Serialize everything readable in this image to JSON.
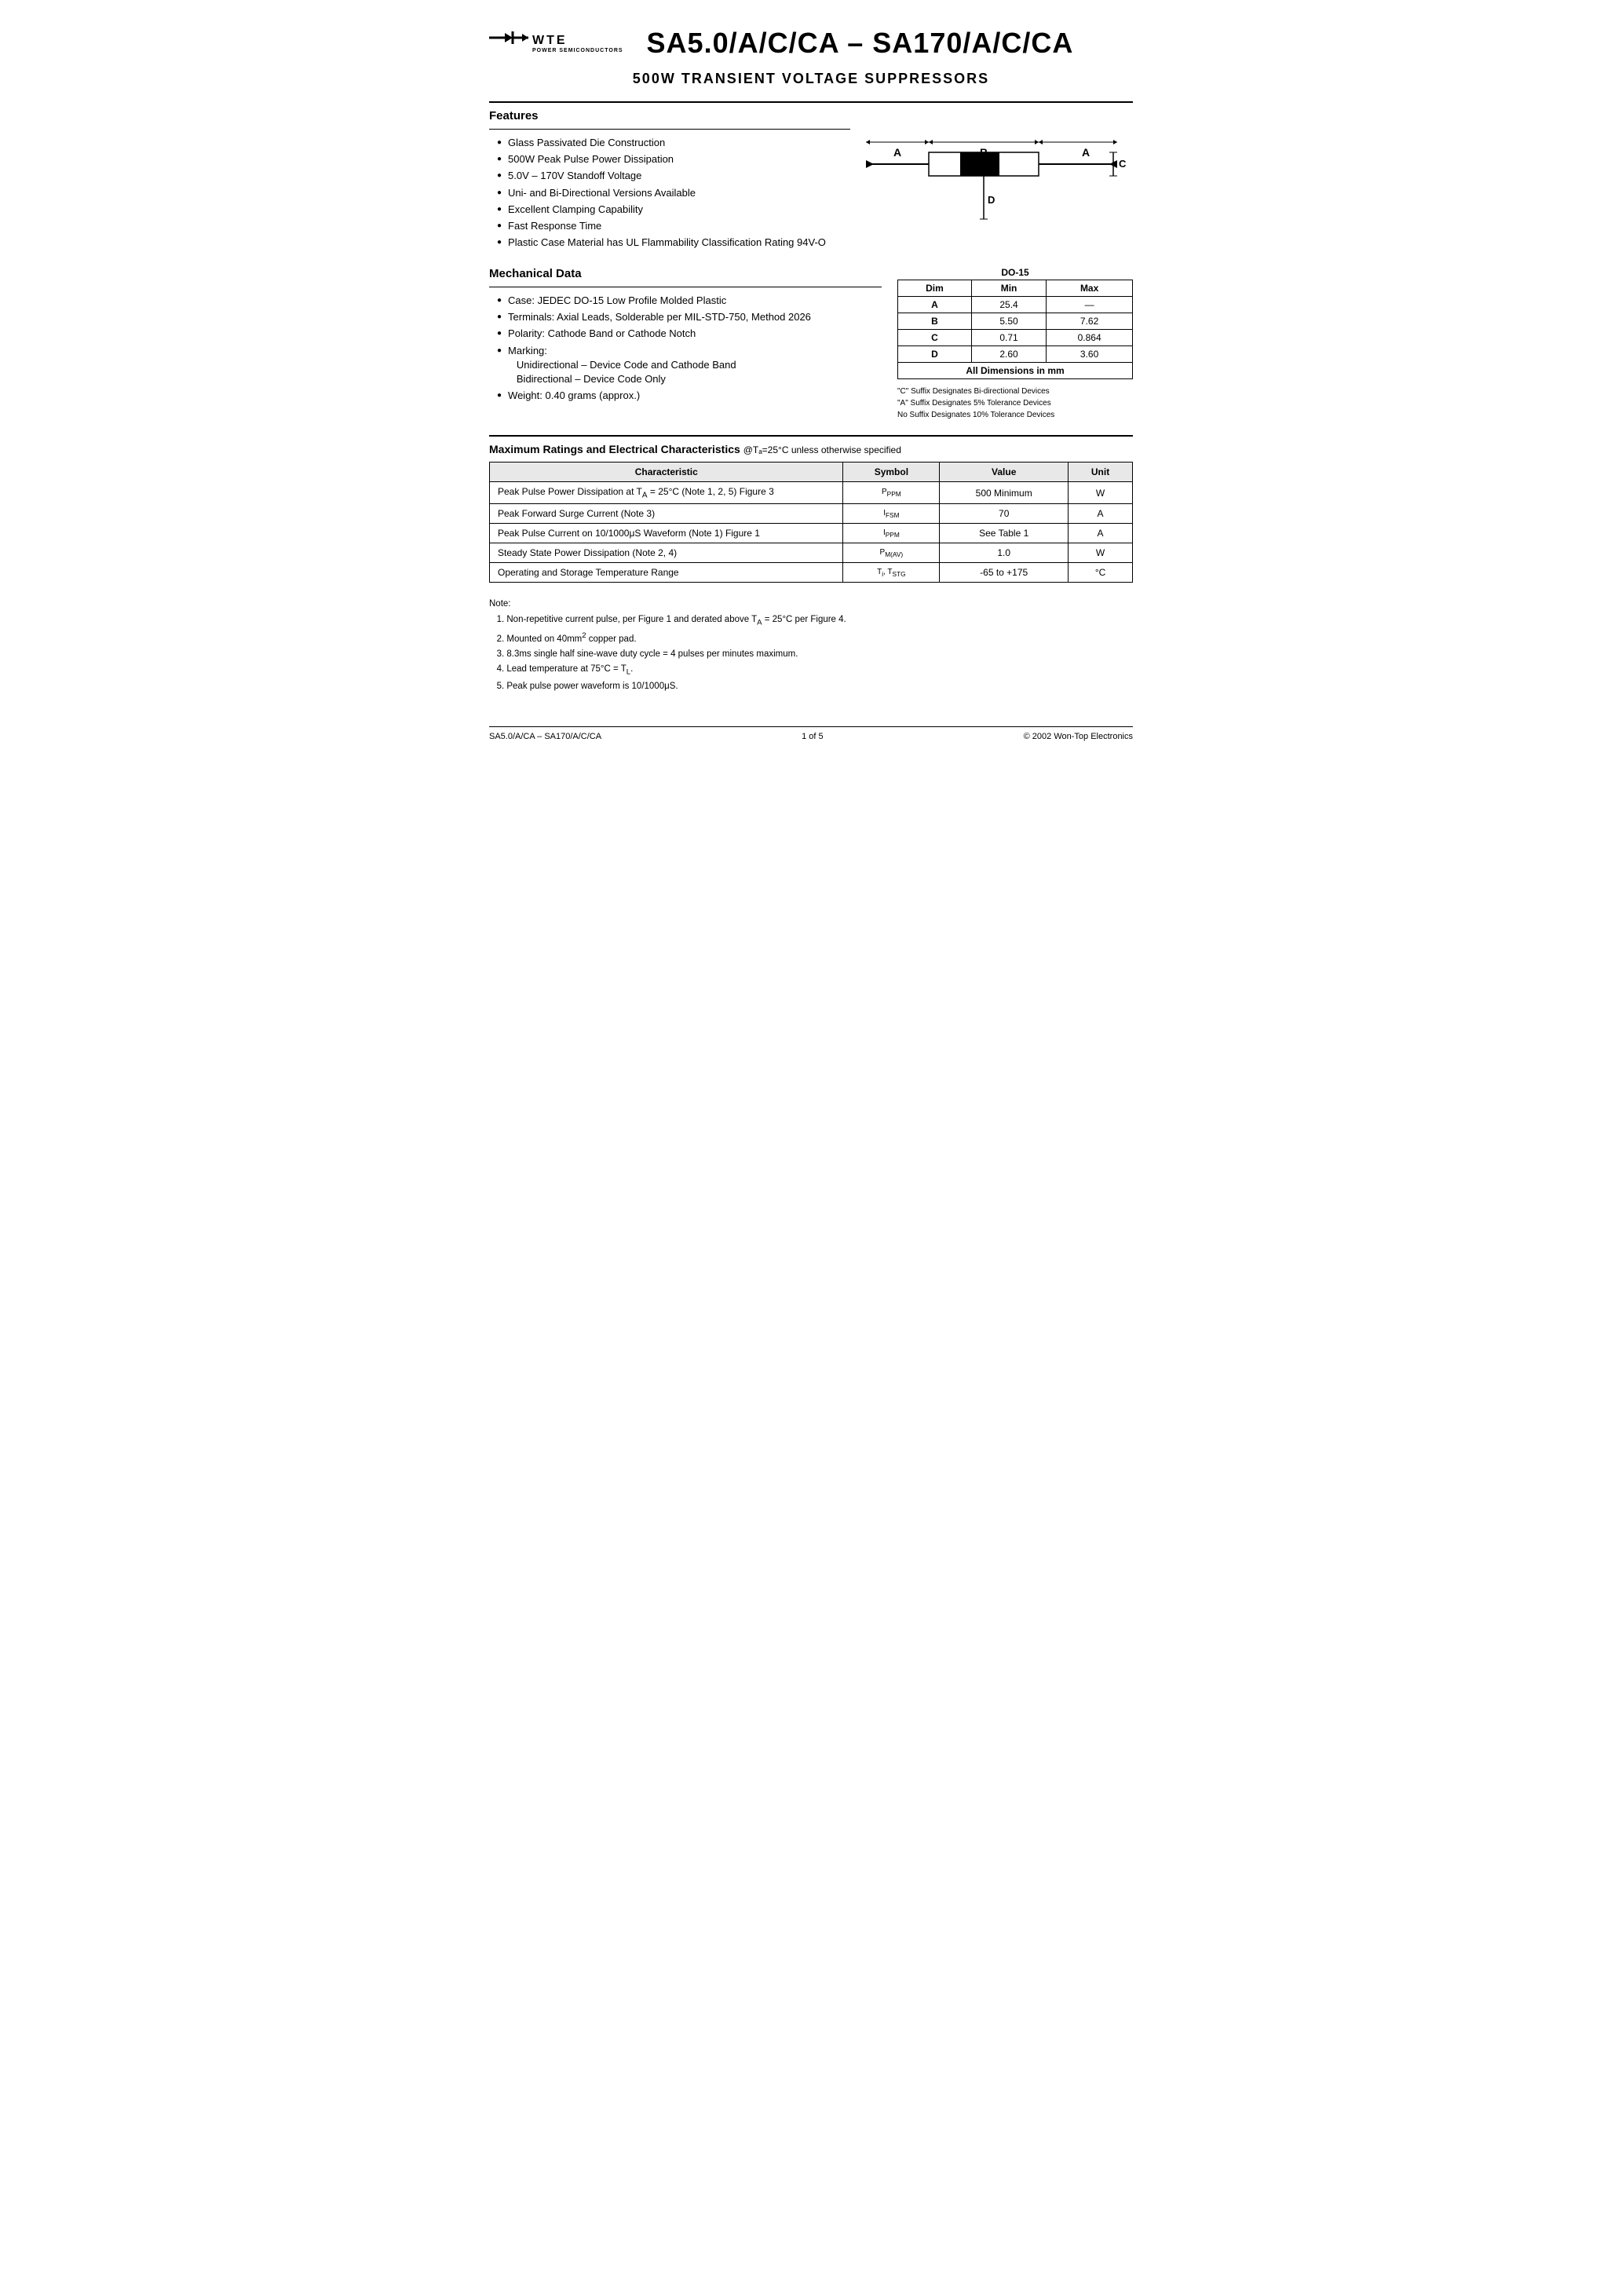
{
  "header": {
    "logo_wte": "WTE",
    "logo_sub": "POWER SEMICONDUCTORS",
    "main_title": "SA5.0/A/C/CA – SA170/A/C/CA",
    "subtitle": "500W TRANSIENT VOLTAGE SUPPRESSORS"
  },
  "features": {
    "section_title": "Features",
    "items": [
      "Glass Passivated Die Construction",
      "500W Peak Pulse Power Dissipation",
      "5.0V – 170V Standoff Voltage",
      "Uni- and Bi-Directional Versions Available",
      "Excellent Clamping Capability",
      "Fast Response Time",
      "Plastic Case Material has UL Flammability Classification Rating 94V-O"
    ]
  },
  "mechanical": {
    "section_title": "Mechanical Data",
    "items": [
      "Case: JEDEC DO-15 Low Profile Molded Plastic",
      "Terminals: Axial Leads, Solderable per MIL-STD-750, Method 2026",
      "Polarity: Cathode Band or Cathode Notch",
      "Marking:",
      "Unidirectional – Device Code and Cathode Band",
      "Bidirectional – Device Code Only",
      "Weight: 0.40 grams (approx.)"
    ]
  },
  "do15": {
    "title": "DO-15",
    "headers": [
      "Dim",
      "Min",
      "Max"
    ],
    "rows": [
      [
        "A",
        "25.4",
        "—"
      ],
      [
        "B",
        "5.50",
        "7.62"
      ],
      [
        "C",
        "0.71",
        "0.864"
      ],
      [
        "D",
        "2.60",
        "3.60"
      ]
    ],
    "footer": "All Dimensions in mm",
    "notes": [
      "\"C\" Suffix Designates Bi-directional Devices",
      "\"A\" Suffix Designates 5% Tolerance Devices",
      "No Suffix Designates 10% Tolerance Devices"
    ]
  },
  "ratings": {
    "title": "Maximum Ratings and Electrical Characteristics",
    "title_note": "@Tₐ=25°C unless otherwise specified",
    "headers": [
      "Characteristic",
      "Symbol",
      "Value",
      "Unit"
    ],
    "rows": [
      {
        "characteristic": "Peak Pulse Power Dissipation at Tₐ = 25°C (Note 1, 2, 5) Figure 3",
        "symbol": "PPPM",
        "value": "500 Minimum",
        "unit": "W"
      },
      {
        "characteristic": "Peak Forward Surge Current (Note 3)",
        "symbol": "IFSM",
        "value": "70",
        "unit": "A"
      },
      {
        "characteristic": "Peak Pulse Current on 10/1000μS Waveform (Note 1) Figure 1",
        "symbol": "IPPM",
        "value": "See Table 1",
        "unit": "A"
      },
      {
        "characteristic": "Steady State Power Dissipation (Note 2, 4)",
        "symbol": "PM(AV)",
        "value": "1.0",
        "unit": "W"
      },
      {
        "characteristic": "Operating and Storage Temperature Range",
        "symbol": "Ti, TSTG",
        "value": "-65 to +175",
        "unit": "°C"
      }
    ]
  },
  "notes": {
    "label": "Note:",
    "items": [
      "1. Non-repetitive current pulse, per Figure 1 and derated above Tₐ = 25°C per Figure 4.",
      "2. Mounted on 40mm² copper pad.",
      "3. 8.3ms single half sine-wave duty cycle = 4 pulses per minutes maximum.",
      "4. Lead temperature at 75°C = Tₗ.",
      "5. Peak pulse power waveform is 10/1000μS."
    ]
  },
  "footer": {
    "left": "SA5.0/A/CA – SA170/A/C/CA",
    "center": "1 of 5",
    "right": "© 2002 Won-Top Electronics"
  }
}
